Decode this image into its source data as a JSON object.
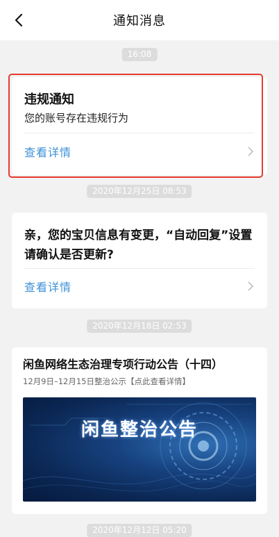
{
  "header": {
    "title": "通知消息"
  },
  "timestamps": [
    "16:08",
    "2020年12月25日 08:53",
    "2020年12月18日 02:53",
    "2020年12月12日 05:20"
  ],
  "cards": [
    {
      "title": "违规通知",
      "subtitle": "您的账号存在违规行为",
      "link": "查看详情"
    },
    {
      "title_line1": "亲，您的宝贝信息有变更，“自动回复”设置",
      "title_line2": "请确认是否更新?",
      "link": "查看详情"
    },
    {
      "title": "闲鱼网络生态治理专项行动公告（十四）",
      "subtitle": "12月9日–12月15日整治公示【点此查看详情】",
      "banner_text": "闲鱼整治公告"
    }
  ],
  "colors": {
    "accent_link": "#3d91d8",
    "highlight": "#e53a2f",
    "pill_bg": "#dcdcdc"
  }
}
